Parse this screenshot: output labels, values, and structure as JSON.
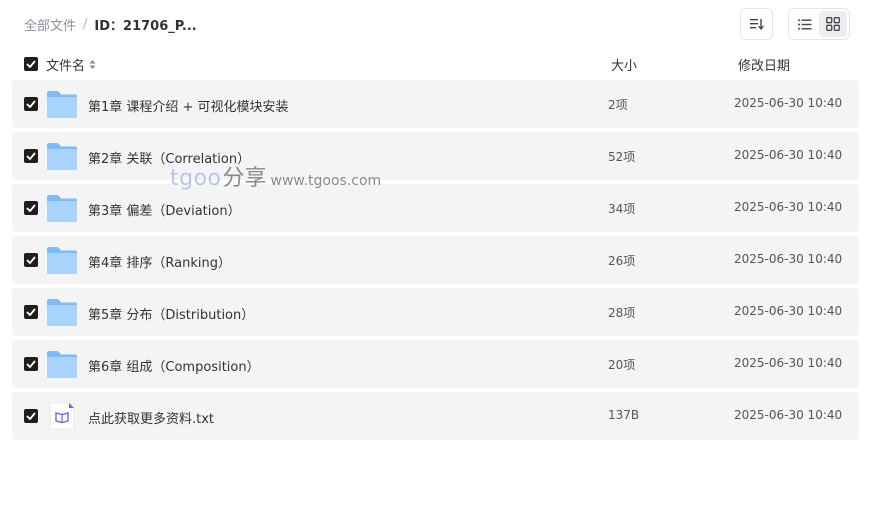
{
  "breadcrumb": {
    "root": "全部文件",
    "separator": "/",
    "current": "ID：21706_P..."
  },
  "toolbar": {
    "sort_icon": "sort-icon",
    "list_view_icon": "list-view-icon",
    "grid_view_icon": "grid-view-icon",
    "active_view": "grid"
  },
  "columns": {
    "name": "文件名",
    "size": "大小",
    "date": "修改日期"
  },
  "rows": [
    {
      "name": "第1章 课程介绍 + 可视化模块安装",
      "size": "2项",
      "date": "2025-06-30 10:40",
      "type": "folder",
      "checked": true
    },
    {
      "name": "第2章 关联（Correlation）",
      "size": "52项",
      "date": "2025-06-30 10:40",
      "type": "folder",
      "checked": true
    },
    {
      "name": "第3章 偏差（Deviation）",
      "size": "34项",
      "date": "2025-06-30 10:40",
      "type": "folder",
      "checked": true
    },
    {
      "name": "第4章 排序（Ranking）",
      "size": "26项",
      "date": "2025-06-30 10:40",
      "type": "folder",
      "checked": true
    },
    {
      "name": "第5章 分布（Distribution）",
      "size": "28项",
      "date": "2025-06-30 10:40",
      "type": "folder",
      "checked": true
    },
    {
      "name": "第6章 组成（Composition）",
      "size": "20项",
      "date": "2025-06-30 10:40",
      "type": "folder",
      "checked": true
    },
    {
      "name": "点此获取更多资料.txt",
      "size": "137B",
      "date": "2025-06-30 10:40",
      "type": "txt",
      "checked": true
    }
  ],
  "watermark": {
    "brand": "tgoo",
    "share": "分享",
    "url": "www.tgoos.com"
  },
  "colors": {
    "folder_light": "#a8d3fb",
    "folder_dark": "#7bbcf7",
    "checkbox": "#1f1f1f",
    "row_bg": "#f4f4f5",
    "txt_icon_accent": "#7a5af8"
  }
}
